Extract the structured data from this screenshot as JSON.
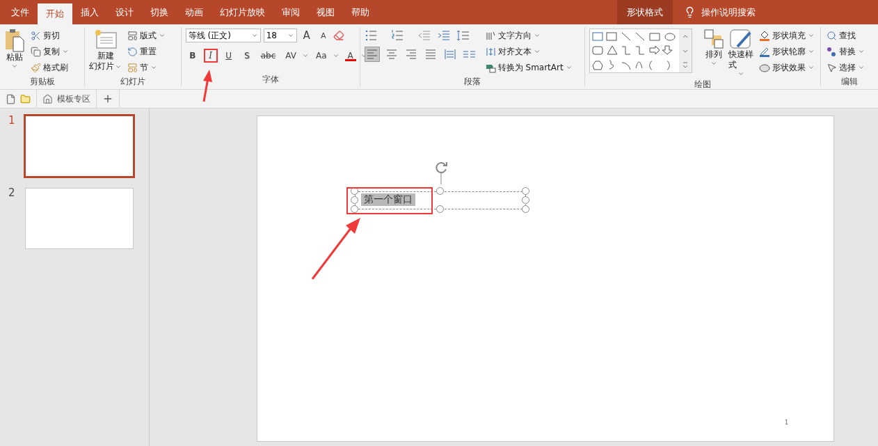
{
  "tabs": [
    {
      "label": "文件",
      "selected": false
    },
    {
      "label": "开始",
      "selected": true
    },
    {
      "label": "插入",
      "selected": false
    },
    {
      "label": "设计",
      "selected": false
    },
    {
      "label": "切换",
      "selected": false
    },
    {
      "label": "动画",
      "selected": false
    },
    {
      "label": "幻灯片放映",
      "selected": false
    },
    {
      "label": "审阅",
      "selected": false
    },
    {
      "label": "视图",
      "selected": false
    },
    {
      "label": "帮助",
      "selected": false
    }
  ],
  "contextual_tab": {
    "label": "形状格式"
  },
  "search": {
    "label": "操作说明搜索"
  },
  "clipboard": {
    "title": "剪贴板",
    "paste": "粘贴",
    "items": [
      {
        "kind": "cut",
        "label": "剪切"
      },
      {
        "kind": "copy",
        "label": "复制"
      },
      {
        "kind": "painter",
        "label": "格式刷"
      }
    ]
  },
  "slides_group": {
    "title": "幻灯片",
    "new_slide": [
      "新建",
      "幻灯片"
    ],
    "items": [
      {
        "kind": "layout",
        "label": "版式"
      },
      {
        "kind": "reset",
        "label": "重置"
      },
      {
        "kind": "section",
        "label": "节"
      }
    ]
  },
  "font": {
    "title": "字体",
    "font_name": "等线 (正文)",
    "font_size": "18",
    "grow": "A",
    "shrink": "A",
    "buttons": [
      {
        "kind": "bold",
        "label": "B",
        "annotated": false
      },
      {
        "kind": "italic",
        "label": "I",
        "annotated": true
      },
      {
        "kind": "underline",
        "label": "U",
        "annotated": false
      },
      {
        "kind": "shadow",
        "label": "S",
        "annotated": false
      },
      {
        "kind": "strike",
        "label": "abc",
        "annotated": false
      },
      {
        "kind": "spacing",
        "label": "AV",
        "annotated": false
      },
      {
        "kind": "case",
        "label": "Aa",
        "annotated": false
      },
      {
        "kind": "color",
        "label": "A",
        "annotated": false
      }
    ]
  },
  "paragraph": {
    "title": "段落",
    "align": [
      {
        "kind": "left",
        "selected": true
      },
      {
        "kind": "center",
        "selected": false
      },
      {
        "kind": "right",
        "selected": false
      },
      {
        "kind": "justify",
        "selected": false
      },
      {
        "kind": "distributed",
        "selected": false
      }
    ],
    "items": [
      {
        "kind": "direction",
        "label": "文字方向"
      },
      {
        "kind": "align-text",
        "label": "对齐文本"
      },
      {
        "kind": "smartart",
        "label": "转换为 SmartArt"
      }
    ]
  },
  "drawing": {
    "title": "绘图",
    "arrange": "排列",
    "quick_styles": "快速样式",
    "items": [
      {
        "kind": "fill",
        "label": "形状填充"
      },
      {
        "kind": "outline",
        "label": "形状轮廓"
      },
      {
        "kind": "effect",
        "label": "形状效果"
      }
    ]
  },
  "editing": {
    "title": "编辑",
    "items": [
      {
        "kind": "find",
        "label": "查找"
      },
      {
        "kind": "replace",
        "label": "替换"
      },
      {
        "kind": "select",
        "label": "选择"
      }
    ]
  },
  "doc_tabs": {
    "template_tab": "模板专区"
  },
  "thumbnails": [
    {
      "number": "1",
      "selected": true
    },
    {
      "number": "2",
      "selected": false
    }
  ],
  "slide": {
    "textbox": "第一个窗口",
    "page_number": "1"
  }
}
